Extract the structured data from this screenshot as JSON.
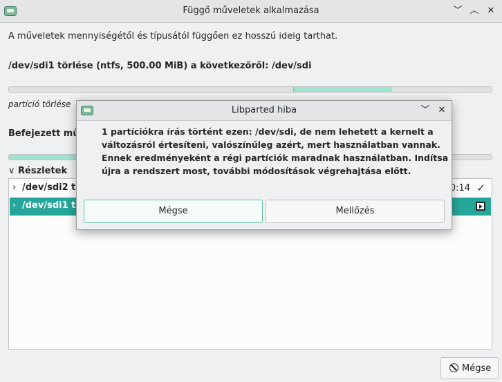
{
  "window": {
    "title": "Függő műveletek alkalmazása"
  },
  "main": {
    "info_text": "A műveletek mennyiségétől és típusától függően ez hosszú ideig tarthat.",
    "operation_text": "/dev/sdi1 törlése (ntfs, 500.00 MiB) a következőről: /dev/sdi",
    "sub_operation_text": "partíció törlése",
    "completed_text": "Befejezett műv",
    "details_label": "Részletek",
    "rows": [
      {
        "label": "/dev/sdi2 tö",
        "time": "0:14",
        "status": "✓"
      },
      {
        "label": "/dev/sdi1 tö",
        "time": "",
        "status": ""
      }
    ],
    "cancel_label": "Mégse"
  },
  "dialog": {
    "title": "Libparted hiba",
    "message_lines": [
      "1 partíciókra írás történt ezen: /dev/sdi, de nem lehetett a kernelt a",
      "változásról értesíteni, valószínűleg azért, mert használatban vannak.",
      "Ennek eredményeként a régi partíciók maradnak használatban. Indítsa",
      "újra a rendszert most, további módosítások végrehajtása előtt."
    ],
    "cancel_label": "Mégse",
    "ignore_label": "Mellőzés"
  },
  "icons": {
    "app": "gparted-icon",
    "minimize": "chevron-down-icon",
    "maximize": "chevron-up-icon",
    "close": "close-icon",
    "expand": "chevron-right-icon",
    "collapse": "chevron-down-icon",
    "success": "check-icon",
    "running": "play-icon",
    "cancel": "cancel-icon"
  },
  "colors": {
    "accent": "#26a69a",
    "progress_fill": "#9fe3d2"
  }
}
